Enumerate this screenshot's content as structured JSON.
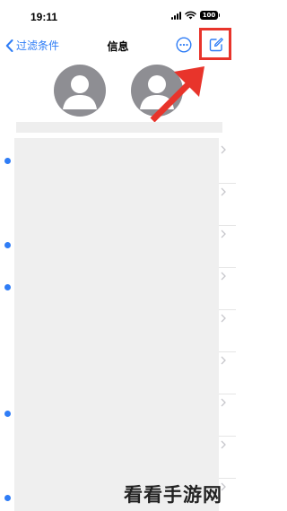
{
  "status_bar": {
    "time": "19:11",
    "battery": "100"
  },
  "nav": {
    "back_label": "过滤条件",
    "title": "信息"
  },
  "icons": {
    "back": "chevron-left-icon",
    "more": "ellipsis-circle-icon",
    "compose": "compose-icon",
    "avatar": "person-silhouette-icon"
  },
  "pinned_contacts": [
    {
      "avatar": "placeholder-avatar"
    },
    {
      "avatar": "placeholder-avatar"
    }
  ],
  "messages": [
    {
      "unread": true
    },
    {
      "unread": false
    },
    {
      "unread": true
    },
    {
      "unread": true
    },
    {
      "unread": false
    },
    {
      "unread": false
    },
    {
      "unread": true
    },
    {
      "unread": false
    },
    {
      "unread": true
    },
    {
      "unread": true
    }
  ],
  "annotation": {
    "shape": "red box and arrow",
    "target": "compose-button"
  },
  "colors": {
    "accent": "#2f7df6",
    "annotation_red": "#e8342b",
    "avatar_gray": "#8e8e93"
  },
  "watermark": "看看手游网"
}
